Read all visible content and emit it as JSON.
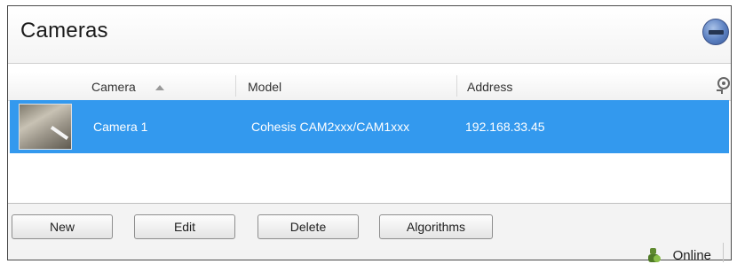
{
  "header": {
    "title": "Cameras"
  },
  "columns": {
    "camera": "Camera",
    "model": "Model",
    "address": "Address"
  },
  "rows": [
    {
      "name": "Camera 1",
      "model": "Cohesis CAM2xxx/CAM1xxx",
      "address": "192.168.33.45"
    }
  ],
  "toolbar": {
    "new_label": "New",
    "edit_label": "Edit",
    "delete_label": "Delete",
    "algorithms_label": "Algorithms"
  },
  "status": {
    "text": "Online"
  },
  "colors": {
    "selection": "#3399ee",
    "header_button": "#5a7fc0"
  },
  "icons": {
    "header": "minimize-icon",
    "columns": "column-settings-icon",
    "status": "online-status-icon",
    "thumb": "camera-thumbnail"
  }
}
